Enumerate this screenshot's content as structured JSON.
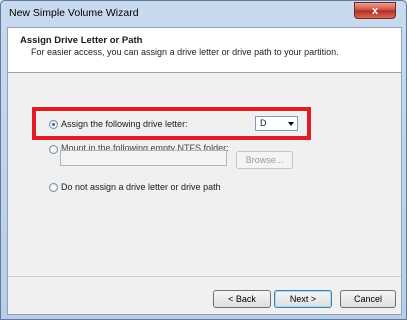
{
  "window": {
    "title": "New Simple Volume Wizard",
    "close_glyph": "x"
  },
  "header": {
    "title": "Assign Drive Letter or Path",
    "subtitle": "For easier access, you can assign a drive letter or drive path to your partition."
  },
  "options": {
    "assign_letter_label": "Assign the following drive letter:",
    "assign_letter_selected": true,
    "mount_folder_label": "Mount in the following empty NTFS folder:",
    "mount_folder_selected": false,
    "no_letter_label": "Do not assign a drive letter or drive path",
    "no_letter_selected": false
  },
  "drive_letter": {
    "value": "D"
  },
  "folder_path": {
    "value": ""
  },
  "buttons": {
    "browse": "Browse...",
    "back": "< Back",
    "next": "Next >",
    "cancel": "Cancel"
  },
  "colors": {
    "highlight": "#e01b24",
    "close_button": "#c9483a"
  }
}
